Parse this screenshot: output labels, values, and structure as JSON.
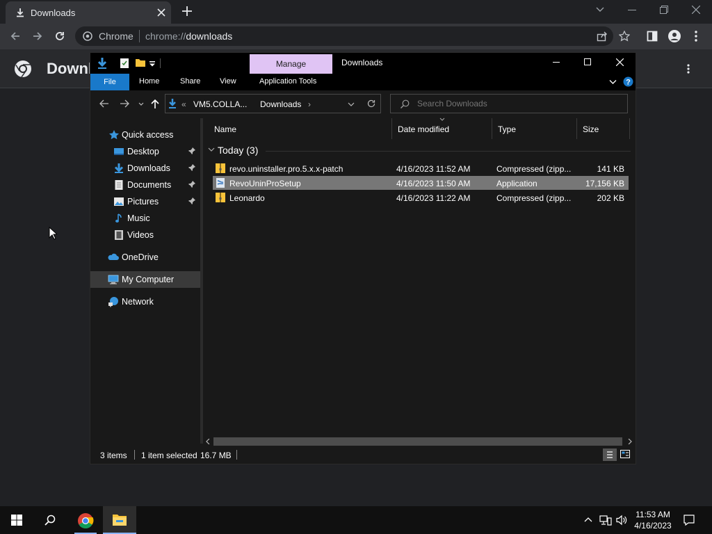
{
  "chrome": {
    "tab_title": "Downloads",
    "omnibox_site": "Chrome",
    "omnibox_scheme": "chrome://",
    "omnibox_host": "downloads",
    "page_title": "Downl"
  },
  "explorer": {
    "manage_label": "Manage",
    "window_title": "Downloads",
    "ribbon_tabs": [
      "File",
      "Home",
      "Share",
      "View",
      "Application Tools"
    ],
    "breadcrumb": [
      "«",
      "VM5.COLLA...",
      "Downloads",
      "›"
    ],
    "search_placeholder": "Search Downloads",
    "nav": {
      "quick_access": "Quick access",
      "desktop": "Desktop",
      "downloads": "Downloads",
      "documents": "Documents",
      "pictures": "Pictures",
      "music": "Music",
      "videos": "Videos",
      "onedrive": "OneDrive",
      "my_computer": "My Computer",
      "network": "Network"
    },
    "columns": [
      "Name",
      "Date modified",
      "Type",
      "Size"
    ],
    "group_label": "Today (3)",
    "files": [
      {
        "name": "revo.uninstaller.pro.5.x.x-patch",
        "date": "4/16/2023 11:52 AM",
        "type": "Compressed (zipp...",
        "size": "141 KB",
        "selected": false
      },
      {
        "name": "RevoUninProSetup",
        "date": "4/16/2023 11:50 AM",
        "type": "Application",
        "size": "17,156 KB",
        "selected": true
      },
      {
        "name": "Leonardo",
        "date": "4/16/2023 11:22 AM",
        "type": "Compressed (zipp...",
        "size": "202 KB",
        "selected": false
      }
    ],
    "status": {
      "items": "3 items",
      "selected": "1 item selected",
      "size": "16.7 MB"
    }
  },
  "taskbar": {
    "time": "11:53 AM",
    "date": "4/16/2023"
  },
  "colors": {
    "explorer_accent": "#1979ca",
    "manage_bg": "#e0c4f4",
    "folder_yellow": "#f8c33a",
    "selection": "#777777"
  }
}
